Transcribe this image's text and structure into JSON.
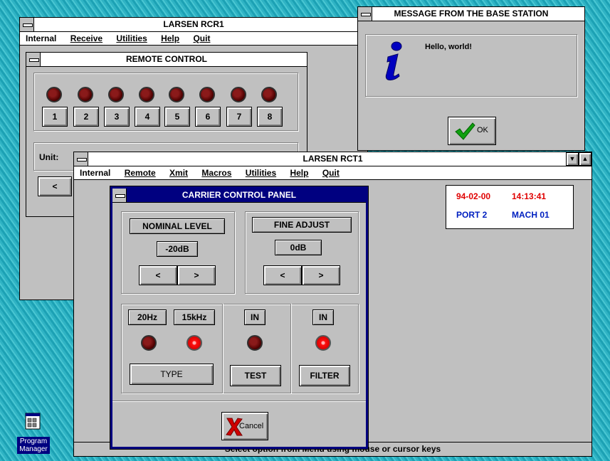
{
  "rcr_window": {
    "title": "LARSEN RCR1",
    "menu": [
      "Internal",
      "Receive",
      "Utilities",
      "Help",
      "Quit"
    ]
  },
  "remote_control": {
    "title": "REMOTE CONTROL",
    "channels": [
      "1",
      "2",
      "3",
      "4",
      "5",
      "6",
      "7",
      "8"
    ],
    "unit_label": "Unit:",
    "prev_label": "<"
  },
  "message_box": {
    "title": "MESSAGE FROM THE BASE STATION",
    "icon": "info-icon",
    "text": "Hello, world!",
    "ok_label": "OK"
  },
  "rct_window": {
    "title": "LARSEN RCT1",
    "menu": [
      "Internal",
      "Remote",
      "Xmit",
      "Macros",
      "Utilities",
      "Help",
      "Quit"
    ],
    "status_bar": "Select option from Menu using mouse or cursor keys",
    "status": {
      "date": "94-02-00",
      "time": "14:13:41",
      "port": "PORT 2",
      "machine": "MACH 01",
      "date_color": "#e00000",
      "port_color": "#0020c0"
    }
  },
  "carrier_panel": {
    "title": "CARRIER CONTROL PANEL",
    "nominal_level": {
      "label": "NOMINAL LEVEL",
      "value": "-20dB",
      "dec": "<",
      "inc": ">"
    },
    "fine_adjust": {
      "label": "FINE ADJUST",
      "value": "0dB",
      "dec": "<",
      "inc": ">"
    },
    "type": {
      "label_a": "20Hz",
      "label_b": "15kHz",
      "button": "TYPE",
      "led_a_on": false,
      "led_b_on": true
    },
    "test": {
      "label": "IN",
      "button": "TEST",
      "led_on": false
    },
    "filter": {
      "label": "IN",
      "button": "FILTER",
      "led_on": true
    },
    "cancel_label": "Cancel"
  },
  "desktop": {
    "program_manager_label_1": "Program",
    "program_manager_label_2": "Manager"
  },
  "colors": {
    "active_title": "#000080",
    "led_on": "#ff1010",
    "led_off": "#5a0000"
  }
}
